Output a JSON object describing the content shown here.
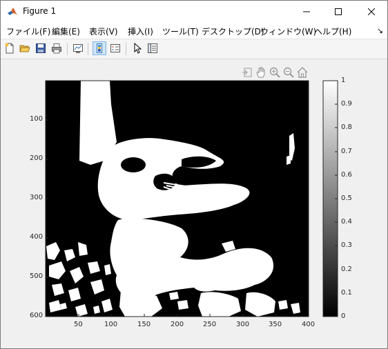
{
  "window": {
    "title": "Figure 1"
  },
  "menu": [
    "ファイル(F)",
    "編集(E)",
    "表示(V)",
    "挿入(I)",
    "ツール(T)",
    "デスクトップ(D)",
    "ウィンドウ(W)",
    "ヘルプ(H)"
  ],
  "toolbar": {
    "buttons": [
      "new-figure",
      "open-file",
      "save",
      "print",
      "link-plot",
      "insert-colorbar",
      "insert-legend",
      "edit-plot",
      "property-inspector"
    ]
  },
  "axes_toolbar": [
    "export",
    "pan",
    "zoom-in",
    "zoom-out",
    "restore-view"
  ],
  "image_axes": {
    "x_ticks": [
      "50",
      "100",
      "150",
      "200",
      "250",
      "300",
      "350",
      "400"
    ],
    "y_ticks": [
      "100",
      "200",
      "300",
      "400",
      "500",
      "600"
    ]
  },
  "colorbar": {
    "ticks": [
      "1",
      "0.9",
      "0.8",
      "0.7",
      "0.6",
      "0.5",
      "0.4",
      "0.3",
      "0.2",
      "0.1",
      "0"
    ]
  },
  "colors": {
    "background": "#f0f0f0",
    "image_black": "#000000",
    "image_white": "#ffffff",
    "accent": "#0078d7"
  }
}
